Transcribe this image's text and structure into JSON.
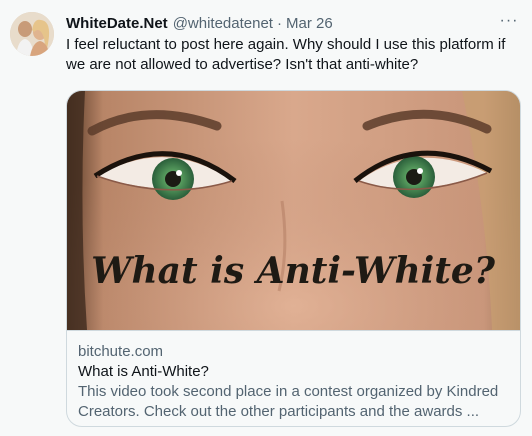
{
  "tweet": {
    "author_name": "WhiteDate.Net",
    "handle": "@whitedatenet",
    "separator": "·",
    "timestamp": "Mar 26",
    "text": "I feel reluctant to post here again. Why should I use this platform if we are not allowed to advertise? Isn't that anti-white?",
    "more_label": "···"
  },
  "card": {
    "image_caption": "What is Anti-White?",
    "domain": "bitchute.com",
    "title": "What is Anti-White?",
    "description": "This video took second place in a contest organized by Kindred Creators. Check out the other participants and the awards ..."
  },
  "colors": {
    "background": "#f7f9f9",
    "text_primary": "#0f1419",
    "text_secondary": "#536471",
    "border": "#cfd9de",
    "iris": "#3f8a52"
  }
}
